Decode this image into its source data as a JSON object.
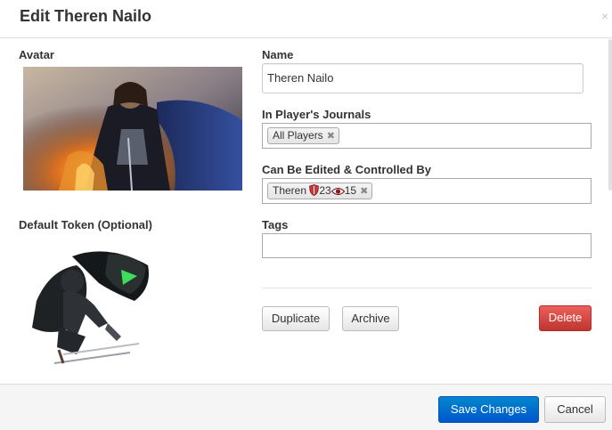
{
  "dialog": {
    "title": "Edit Theren Nailo",
    "close_glyph": "×"
  },
  "left": {
    "avatar_label": "Avatar",
    "default_token_label": "Default Token (Optional)"
  },
  "fields": {
    "name_label": "Name",
    "name_value": "Theren Nailo",
    "journals_label": "In Player's Journals",
    "journals_chips": [
      "All Players"
    ],
    "controlled_label": "Can Be Edited & Controlled By",
    "controlled_chip": {
      "name": "Theren",
      "shield_value": "23",
      "eye_value": "15"
    },
    "tags_label": "Tags",
    "tags_value": ""
  },
  "actions": {
    "duplicate": "Duplicate",
    "archive": "Archive",
    "delete": "Delete"
  },
  "footer": {
    "save": "Save Changes",
    "cancel": "Cancel"
  },
  "colors": {
    "delete_button": "#d9534f",
    "save_button": "#0074cc"
  }
}
